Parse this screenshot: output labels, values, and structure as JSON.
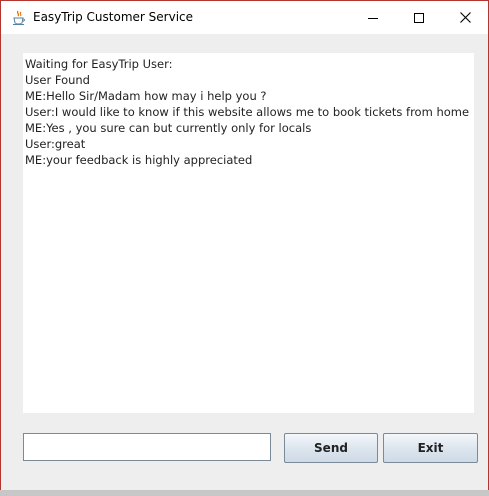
{
  "window": {
    "title": "EasyTrip Customer Service",
    "icons": {
      "app": "java-cup-icon",
      "minimize": "minimize-icon",
      "maximize": "maximize-icon",
      "close": "close-icon"
    },
    "colors": {
      "border": "#b3362e",
      "titlebar": "#ffffff",
      "content_bg": "#eeeeee"
    }
  },
  "chat": {
    "lines": [
      "Waiting for EasyTrip User:",
      "User Found",
      "ME:Hello Sir/Madam how may i help you ?",
      "User:I would like to know if this website allows me to book tickets from home  ?",
      "ME:Yes , you sure can but currently only for locals",
      "User:great",
      "ME:your feedback is highly appreciated"
    ]
  },
  "input": {
    "value": "",
    "placeholder": ""
  },
  "buttons": {
    "send": "Send",
    "exit": "Exit"
  }
}
